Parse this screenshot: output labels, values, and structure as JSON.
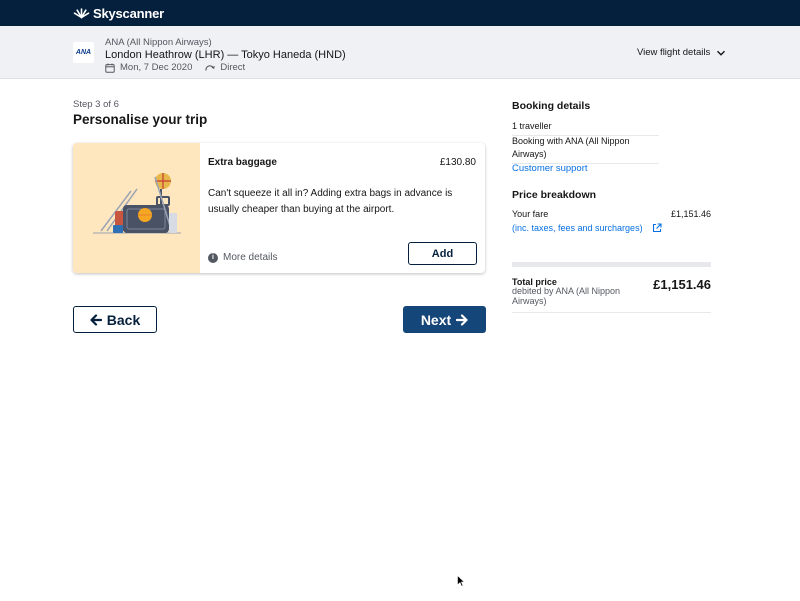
{
  "brand": {
    "name": "Skyscanner"
  },
  "flight": {
    "airline_logo_text": "ANA",
    "airline": "ANA (All Nippon Airways)",
    "route": "London Heathrow (LHR) — Tokyo Haneda (HND)",
    "date": "Mon, 7 Dec 2020",
    "stops": "Direct",
    "view_details": "View flight details"
  },
  "step": {
    "label": "Step 3 of 6",
    "title": "Personalise your trip"
  },
  "extra_card": {
    "title": "Extra baggage",
    "price": "£130.80",
    "description": "Can't squeeze it all in? Adding extra bags in advance is usually cheaper than buying at the airport.",
    "more_details": "More details",
    "info_glyph": "i",
    "add_label": "Add",
    "illustration_bg": "#fee6bf"
  },
  "nav": {
    "back_label": "Back",
    "next_label": "Next"
  },
  "booking": {
    "title": "Booking details",
    "travellers": "1 traveller",
    "booking_with": "Booking with ANA (All Nippon Airways)",
    "support_link": "Customer support"
  },
  "price": {
    "title": "Price breakdown",
    "fare_label": "Your fare",
    "fare_value": "£1,151.46",
    "taxes_link": "(inc. taxes, fees and surcharges)",
    "total_label": "Total price",
    "total_sub": "debited by ANA (All Nippon Airways)",
    "total_value": "£1,151.46"
  },
  "colors": {
    "topbar": "#05203c",
    "primary_button": "#154679",
    "link": "#0770e3",
    "flightbar_bg": "#eff1f4"
  },
  "icons": {
    "logo": "skyscanner-sunburst-icon",
    "date": "calendar-icon",
    "stops": "direct-arrow-icon",
    "chevron": "chevron-down-icon",
    "info": "info-icon",
    "external": "external-link-icon",
    "back": "arrow-left-icon",
    "next": "arrow-right-icon"
  }
}
